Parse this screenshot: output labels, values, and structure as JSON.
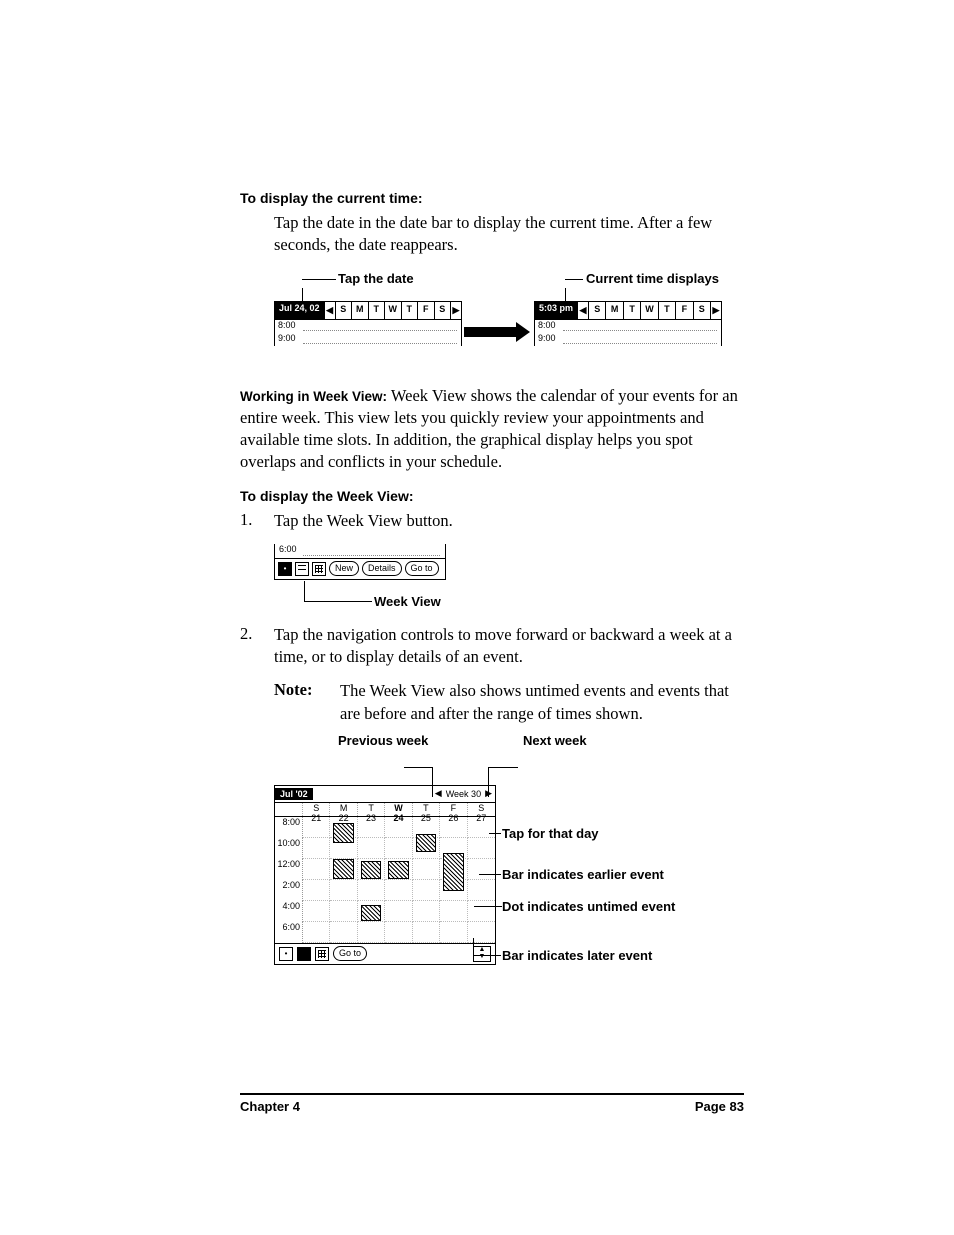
{
  "section1": {
    "heading": "To display the current time:",
    "body": "Tap the date in the date bar to display the current time. After a few seconds, the date reappears."
  },
  "fig1": {
    "callout_left": "Tap the date",
    "callout_right": "Current time displays",
    "left_date": "Jul 24, 02",
    "right_time": "5:03 pm",
    "days": [
      "S",
      "M",
      "T",
      "W",
      "T",
      "F",
      "S"
    ],
    "hours": [
      "8:00",
      "9:00"
    ]
  },
  "para_week": {
    "runin": "Working in Week View:",
    "text": " Week View shows the calendar of your events for an entire week. This view lets you quickly review your appointments and available time slots. In addition, the graphical display helps you spot overlaps and conflicts in your schedule."
  },
  "section2": {
    "heading": "To display the Week View:",
    "step1_num": "1.",
    "step1": "Tap the Week View button.",
    "step2_num": "2.",
    "step2": "Tap the navigation controls to move forward or backward a week at a time, or to display details of an event.",
    "note_label": "Note:",
    "note_text": "The Week View also shows untimed events and events that are before and after the range of times shown."
  },
  "fig2": {
    "hour": "6:00",
    "buttons": {
      "new": "New",
      "details": "Details",
      "goto": "Go to"
    },
    "callout": "Week View"
  },
  "fig3": {
    "callout_prev": "Previous week",
    "callout_next": "Next week",
    "callout_day": "Tap for that day",
    "callout_earlier": "Bar indicates earlier event",
    "callout_untimed": "Dot indicates untimed event",
    "callout_later": "Bar indicates later event",
    "month": "Jul '02",
    "weeknum": "Week 30",
    "day_letters": [
      "S",
      "M",
      "T",
      "W",
      "T",
      "F",
      "S"
    ],
    "day_nums": [
      "21",
      "22",
      "23",
      "24",
      "25",
      "26",
      "27"
    ],
    "times": [
      "8:00",
      "10:00",
      "12:00",
      "2:00",
      "4:00",
      "6:00"
    ],
    "goto": "Go to"
  },
  "footer": {
    "left": "Chapter 4",
    "right": "Page 83"
  }
}
